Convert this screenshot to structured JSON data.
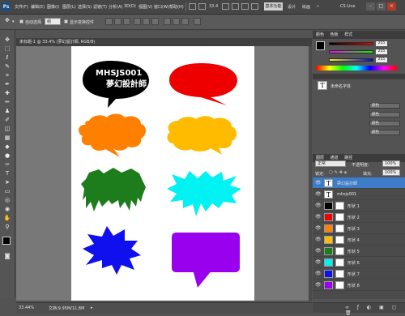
{
  "menubar": {
    "app_badge": "Ps",
    "menus": [
      "文件(F)",
      "编辑(E)",
      "图像(I)",
      "图层(L)",
      "选择(S)",
      "滤镜(T)",
      "分析(A)",
      "3D(D)",
      "视图(V)",
      "窗口(W)",
      "帮助(H)"
    ],
    "zoom": "33.4",
    "workspace_active": "基本功能",
    "workspaces": [
      "设计",
      "绘画"
    ],
    "cs_live": "CS Live"
  },
  "options": {
    "auto_select_label": "自动选择",
    "auto_select_target": "组",
    "show_transform_label": "显示变换控件"
  },
  "document": {
    "tab_title": "未标题-1 @ 33.4% (夢幻設計師, RGB/8)",
    "status_zoom": "33.44%",
    "status_doc": "文档:9.95M/11.8M"
  },
  "canvas_text": {
    "line1": "MHSJS001",
    "line2": "夢幻設計師"
  },
  "colors": {
    "black_bubble": "#000000",
    "red_bubble": "#ee0000",
    "orange_bubble": "#ff7f00",
    "yellow_bubble": "#ffbb00",
    "green_bubble": "#1d7d1d",
    "cyan_bubble": "#00f2f2",
    "blue_bubble": "#1010ee",
    "purple_bubble": "#9900ee",
    "accent": "#3d7cc9"
  },
  "panels": {
    "color_tab": "颜色",
    "swatches_tab": "色板",
    "style_tab": "样式",
    "slider_values": [
      "255",
      "255",
      "255"
    ],
    "char_preview_label": "T",
    "char_style_name": "未命名字体",
    "adjust_buttons": [
      "颜色",
      "颜色",
      "颜色",
      "颜色"
    ],
    "layers_tab": "图层",
    "channels_tab": "通道",
    "paths_tab": "路径",
    "blend_mode": "正常",
    "opacity_label": "不透明度:",
    "opacity_value": "100%",
    "lock_label": "锁定:",
    "fill_label": "填充:",
    "fill_value": "100%"
  },
  "layers": [
    {
      "name": "夢幻設計師",
      "type": "text",
      "selected": true
    },
    {
      "name": "mhsjs001",
      "type": "text",
      "selected": false
    },
    {
      "name": "形状 1",
      "type": "shape",
      "color": "#000000"
    },
    {
      "name": "形状 2",
      "type": "shape",
      "color": "#ee0000"
    },
    {
      "name": "形状 3",
      "type": "shape",
      "color": "#ff7f00"
    },
    {
      "name": "形状 4",
      "type": "shape",
      "color": "#ffbb00"
    },
    {
      "name": "形状 5",
      "type": "shape",
      "color": "#1d7d1d"
    },
    {
      "name": "形状 6",
      "type": "shape",
      "color": "#00f2f2"
    },
    {
      "name": "形状 7",
      "type": "shape",
      "color": "#1010ee"
    },
    {
      "name": "形状 8",
      "type": "shape",
      "color": "#9900ee"
    }
  ]
}
